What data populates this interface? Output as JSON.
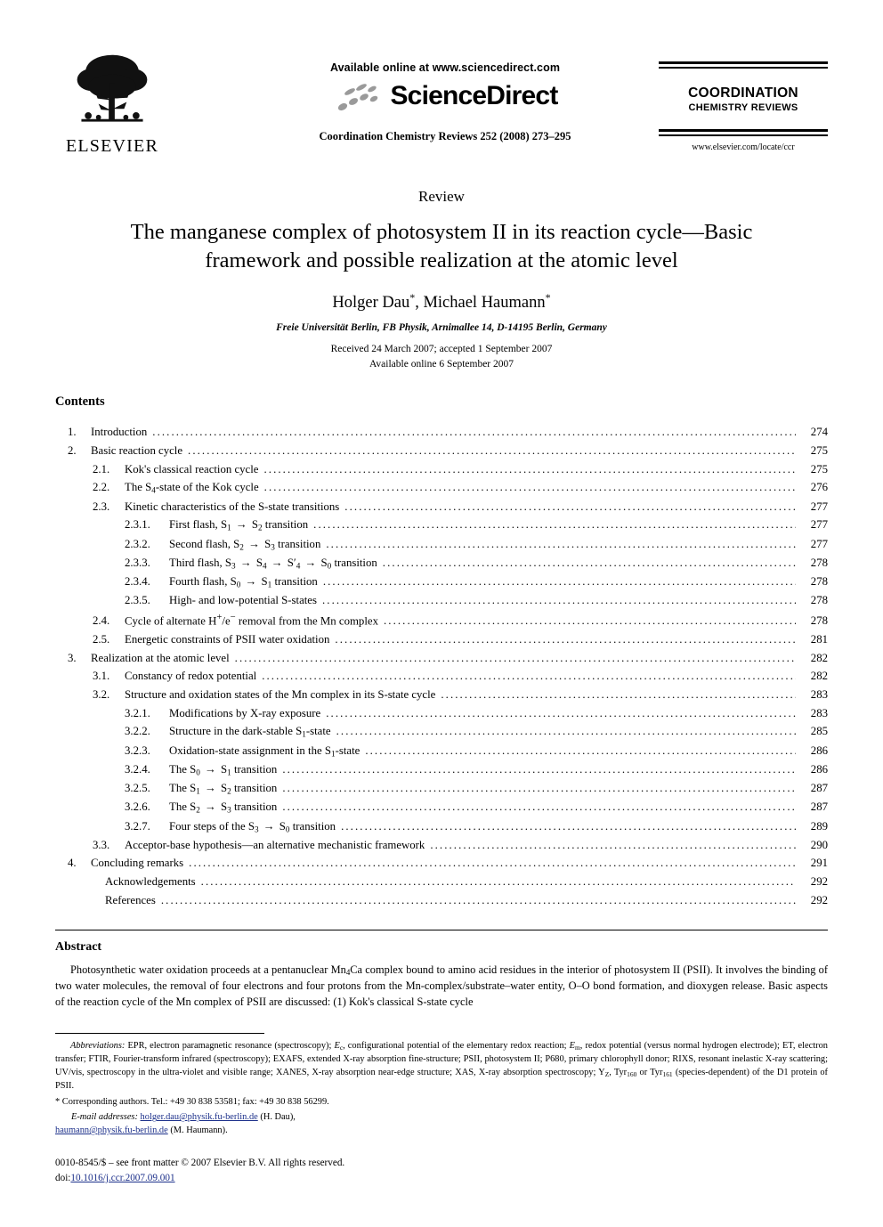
{
  "masthead": {
    "publisher": "ELSEVIER",
    "available_online": "Available online at www.sciencedirect.com",
    "sciencedirect": "ScienceDirect",
    "journal_reference": "Coordination Chemistry Reviews 252 (2008) 273–295",
    "cover_title": "COORDINATION",
    "cover_subtitle": "CHEMISTRY REVIEWS",
    "cover_url": "www.elsevier.com/locate/ccr"
  },
  "article": {
    "doc_type": "Review",
    "title": "The manganese complex of photosystem II in its reaction cycle—Basic framework and possible realization at the atomic level",
    "authors": "Holger Dau",
    "authors_second": ", Michael Haumann",
    "corresponding_mark": "*",
    "affiliation": "Freie Universität Berlin, FB Physik, Arnimallee 14, D-14195 Berlin, Germany",
    "received": "Received 24 March 2007; accepted 1 September 2007",
    "available": "Available online 6 September 2007"
  },
  "contents": {
    "heading": "Contents",
    "entries": [
      {
        "level": 1,
        "num": "1.",
        "label": "Introduction",
        "page": "274"
      },
      {
        "level": 1,
        "num": "2.",
        "label": "Basic reaction cycle",
        "page": "275"
      },
      {
        "level": 2,
        "num": "2.1.",
        "label": "Kok's classical reaction cycle",
        "page": "275"
      },
      {
        "level": 2,
        "num": "2.2.",
        "label": "The S<sub>4</sub>-state of the Kok cycle",
        "page": "276"
      },
      {
        "level": 2,
        "num": "2.3.",
        "label": "Kinetic characteristics of the S-state transitions",
        "page": "277"
      },
      {
        "level": 3,
        "num": "2.3.1.",
        "label": "First flash, S<sub>1</sub> <span class='arrow'>→</span> S<sub>2</sub> transition",
        "page": "277"
      },
      {
        "level": 3,
        "num": "2.3.2.",
        "label": "Second flash, S<sub>2</sub> <span class='arrow'>→</span> S<sub>3</sub> transition",
        "page": "277"
      },
      {
        "level": 3,
        "num": "2.3.3.",
        "label": "Third flash, S<sub>3</sub> <span class='arrow'>→</span> S<sub>4</sub> <span class='arrow'>→</span> S′<sub>4</sub> <span class='arrow'>→</span> S<sub>0</sub> transition",
        "page": "278"
      },
      {
        "level": 3,
        "num": "2.3.4.",
        "label": "Fourth flash, S<sub>0</sub> <span class='arrow'>→</span> S<sub>1</sub> transition",
        "page": "278"
      },
      {
        "level": 3,
        "num": "2.3.5.",
        "label": "High- and low-potential S-states",
        "page": "278"
      },
      {
        "level": 2,
        "num": "2.4.",
        "label": "Cycle of alternate H<sup>+</sup>/e<sup>−</sup> removal from the Mn complex",
        "page": "278"
      },
      {
        "level": 2,
        "num": "2.5.",
        "label": "Energetic constraints of PSII water oxidation",
        "page": "281"
      },
      {
        "level": 1,
        "num": "3.",
        "label": "Realization at the atomic level",
        "page": "282"
      },
      {
        "level": 2,
        "num": "3.1.",
        "label": "Constancy of redox potential",
        "page": "282"
      },
      {
        "level": 2,
        "num": "3.2.",
        "label": "Structure and oxidation states of the Mn complex in its S-state cycle",
        "page": "283"
      },
      {
        "level": 3,
        "num": "3.2.1.",
        "label": "Modifications by X-ray exposure",
        "page": "283"
      },
      {
        "level": 3,
        "num": "3.2.2.",
        "label": "Structure in the dark-stable S<sub>1</sub>-state",
        "page": "285"
      },
      {
        "level": 3,
        "num": "3.2.3.",
        "label": "Oxidation-state assignment in the S<sub>1</sub>-state",
        "page": "286"
      },
      {
        "level": 3,
        "num": "3.2.4.",
        "label": "The S<sub>0</sub> <span class='arrow'>→</span> S<sub>1</sub> transition",
        "page": "286"
      },
      {
        "level": 3,
        "num": "3.2.5.",
        "label": "The S<sub>1</sub> <span class='arrow'>→</span> S<sub>2</sub> transition",
        "page": "287"
      },
      {
        "level": 3,
        "num": "3.2.6.",
        "label": "The S<sub>2</sub> <span class='arrow'>→</span> S<sub>3</sub> transition",
        "page": "287"
      },
      {
        "level": 3,
        "num": "3.2.7.",
        "label": "Four steps of the S<sub>3</sub> <span class='arrow'>→</span> S<sub>0</sub> transition",
        "page": "289"
      },
      {
        "level": 2,
        "num": "3.3.",
        "label": "Acceptor-base hypothesis—an alternative mechanistic framework",
        "page": "290"
      },
      {
        "level": 1,
        "num": "4.",
        "label": "Concluding remarks",
        "page": "291"
      },
      {
        "level": 0,
        "num": "",
        "label": "Acknowledgements",
        "page": "292"
      },
      {
        "level": 0,
        "num": "",
        "label": "References",
        "page": "292"
      }
    ]
  },
  "abstract": {
    "heading": "Abstract",
    "text": "Photosynthetic water oxidation proceeds at a pentanuclear Mn4Ca complex bound to amino acid residues in the interior of photosystem II (PSII). It involves the binding of two water molecules, the removal of four electrons and four protons from the Mn-complex/substrate–water entity, O–O bond formation, and dioxygen release. Basic aspects of the reaction cycle of the Mn complex of PSII are discussed: (1) Kok's classical S-state cycle"
  },
  "footnotes": {
    "abbrev_label": "Abbreviations:",
    "abbrev_text": "EPR, electron paramagnetic resonance (spectroscopy); Ec, configurational potential of the elementary redox reaction; Em, redox potential (versus normal hydrogen electrode); ET, electron transfer; FTIR, Fourier-transform infrared (spectroscopy); EXAFS, extended X-ray absorption fine-structure; PSII, photosystem II; P680, primary chlorophyll donor; RIXS, resonant inelastic X-ray scattering; UV/vis, spectroscopy in the ultra-violet and visible range; XANES, X-ray absorption near-edge structure; XAS, X-ray absorption spectroscopy; YZ, Tyr160 or Tyr161 (species-dependent) of the D1 protein of PSII.",
    "corresponding": "* Corresponding authors. Tel.: +49 30 838 53581; fax: +49 30 838 56299.",
    "email_label": "E-mail addresses:",
    "email_1": "holger.dau@physik.fu-berlin.de",
    "email_1_name": " (H. Dau),",
    "email_2": "haumann@physik.fu-berlin.de",
    "email_2_name": " (M. Haumann)."
  },
  "copyright": {
    "line1": "0010-8545/$ – see front matter © 2007 Elsevier B.V. All rights reserved.",
    "doi_prefix": "doi:",
    "doi": "10.1016/j.ccr.2007.09.001"
  }
}
